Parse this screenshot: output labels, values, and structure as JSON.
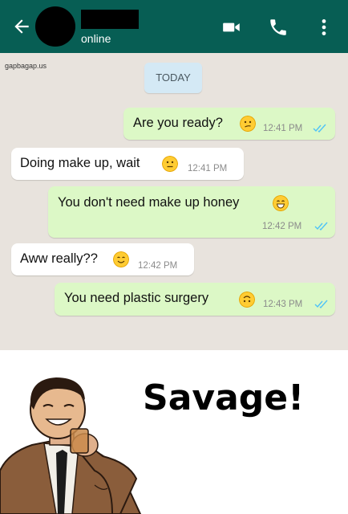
{
  "header": {
    "status": "online",
    "icons": [
      "back-arrow-icon",
      "video-call-icon",
      "phone-icon",
      "more-options-icon"
    ],
    "background_color": "#075e54"
  },
  "chat": {
    "watermark": "gapbagap.us",
    "date_label": "TODAY",
    "messages": [
      {
        "direction": "outgoing",
        "text": "Are you ready?",
        "emoji": "confused-face",
        "time": "12:41 PM",
        "read": true
      },
      {
        "direction": "incoming",
        "text": "Doing make up, wait",
        "emoji": "neutral-face",
        "time": "12:41 PM"
      },
      {
        "direction": "outgoing",
        "text": "You don't need make up honey",
        "emoji": "grinning-face",
        "time": "12:42 PM",
        "read": true
      },
      {
        "direction": "incoming",
        "text": "Aww really??",
        "emoji": "smiling-face",
        "time": "12:42 PM"
      },
      {
        "direction": "outgoing",
        "text": "You need plastic surgery",
        "emoji": "upside-down-face",
        "time": "12:43 PM",
        "read": true
      }
    ],
    "colors": {
      "outgoing_bubble": "#dcf8c6",
      "incoming_bubble": "#ffffff",
      "read_ticks": "#4fc3f7"
    }
  },
  "caption": {
    "text": "Savage!"
  }
}
